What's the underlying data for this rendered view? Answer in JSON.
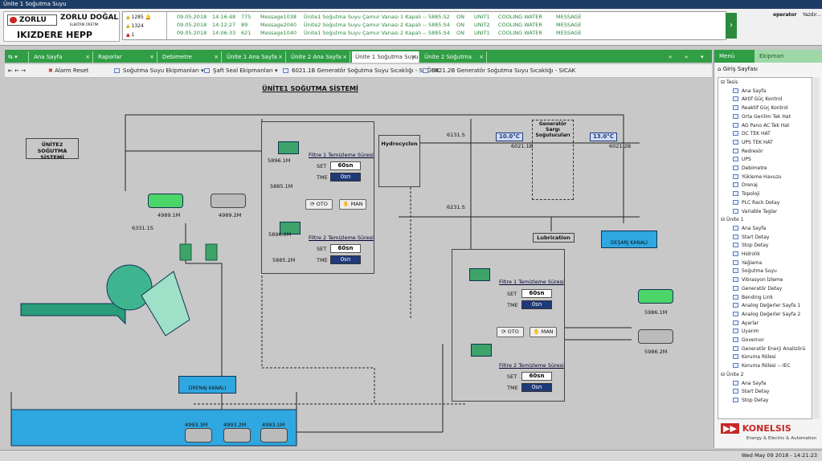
{
  "window": {
    "title": "Ünite 1 Soğutma Suyu"
  },
  "header": {
    "logo_top_left": "ZORLU",
    "logo_top_right": "ZORLU DOĞAL",
    "logo_sub": "ELEKTRİK ÜRETİM",
    "plant": "IKIZDERE HEPP",
    "counts": [
      "1285",
      "1324",
      "1"
    ],
    "alarms": [
      {
        "date": "09.05.2018",
        "time": "14:16:48",
        "id": "775",
        "msg": "Message1038",
        "desc": "Ünite1 Soğutma Suyu Çamur Vanası 1 Kapalı -- 5885.S2",
        "state": "ON",
        "unit": "UNIT1",
        "group": "COOLING WATER",
        "type": "MESSAGE"
      },
      {
        "date": "09.05.2018",
        "time": "14:12:27",
        "id": "89",
        "msg": "Message2040",
        "desc": "Ünite2 Soğutma Suyu Çamur Vanası 2 Kapalı -- 5885.S4",
        "state": "ON",
        "unit": "UNIT2",
        "group": "COOLING WATER",
        "type": "MESSAGE"
      },
      {
        "date": "09.05.2018",
        "time": "14:06:33",
        "id": "621",
        "msg": "Message1040",
        "desc": "Ünite1 Soğutma Suyu Çamur Vanası 2 Kapalı -- 5885.S4",
        "state": "ON",
        "unit": "UNIT1",
        "group": "COOLING WATER",
        "type": "MESSAGE"
      }
    ],
    "user": "operator",
    "help": "Yazdır..."
  },
  "tabs": [
    "Ana Sayfa",
    "Raporlar",
    "Debimetre",
    "Ünite 1 Ana Sayfa",
    "Ünite 2 Ana Sayfa",
    "Ünite 1 Soğutma Suyu",
    "Ünite 2 Soğutma Suyu"
  ],
  "toolbar": {
    "alarm_reset": "Alarm Reset",
    "eq1": "Soğutma Suyu Ekipmanları",
    "eq2": "Şaft Seal Ekipmanları",
    "link1": "6021.1B Generatör Soğutma Suyu Sıcaklığı - SOĞUK",
    "link2": "6021.2B Generatör Soğutma Suyu Sıcaklığı - SICAK"
  },
  "diagram": {
    "title": "ÜNİTE1 SOĞUTMA SİSTEMİ",
    "unite2": "ÜNİTE2 SOĞUTMA SİSTEMİ",
    "hydro": "Hydrocyclon",
    "gen": "Generatör Sargı Soğutucuları",
    "lub": "Lubrication",
    "desarj": "DEŞARJ KANALI",
    "drenaj": "DRENAJ KANALI",
    "temp1": "10.0°C",
    "temp2": "13.0°C",
    "t1tag": "6021.1B",
    "t2tag": "6021.2B",
    "f1": "Filtre 1 Temizleme Süresi",
    "f2": "Filtre 2 Temizleme Süresi",
    "set": "SET",
    "tme": "TME",
    "sn": "60sn",
    "zero": "0sn",
    "oto": "OTO",
    "man": "MAN",
    "tags": {
      "a": "5896.1M",
      "b": "5885.1M",
      "c": "5896.2M",
      "d": "5885.2M",
      "e": "4989.1M",
      "f": "4989.2M",
      "g": "6331.1S",
      "h": "6131.S",
      "i": "6231.S",
      "j": "5986.1M",
      "k": "5986.2M",
      "l": "4993.3M",
      "m": "4993.2M",
      "n": "4993.1M"
    }
  },
  "right": {
    "menu": "Menü",
    "ekipman": "Ekipman",
    "giris": "Giriş Sayfası",
    "tesis": "Tesis",
    "unite1": "Ünite 1",
    "unite2": "Ünite 2",
    "tesis_items": [
      "Ana Sayfa",
      "Aktif Güç Kontrol",
      "Reaktif Güç Kontrol",
      "Orta Gerilim Tek Hat",
      "AG Pano AC Tek Hat",
      "DC TEK HAT",
      "UPS TEK HAT",
      "Redresör",
      "UPS",
      "Debimetre",
      "Yükleme Havuzu",
      "Drenaj",
      "Topoloji",
      "PLC Rack Detay",
      "Variable Taglar"
    ],
    "unite1_items": [
      "Ana Sayfa",
      "Start Detay",
      "Stop Detay",
      "Hidrolik",
      "Yağlama",
      "Soğutma Suyu",
      "Vibrasyon İzleme",
      "Generatör Detay",
      "Bending Link",
      "Analog Değerler Sayfa 1",
      "Analog Değerler Sayfa 2",
      "Ayarlar",
      "Uyarım",
      "Governor",
      "Generatör Enerji Analizörü",
      "Koruma Rölesi",
      "Koruma Rölesi -- IEC"
    ],
    "unite2_items": [
      "Ana Sayfa",
      "Start Detay",
      "Stop Detay"
    ],
    "brand": "KONELSIS",
    "brand_sub": "Energy & Electric & Automation"
  },
  "status": {
    "datetime": "Wed May 09 2018 - 14:21:23"
  }
}
